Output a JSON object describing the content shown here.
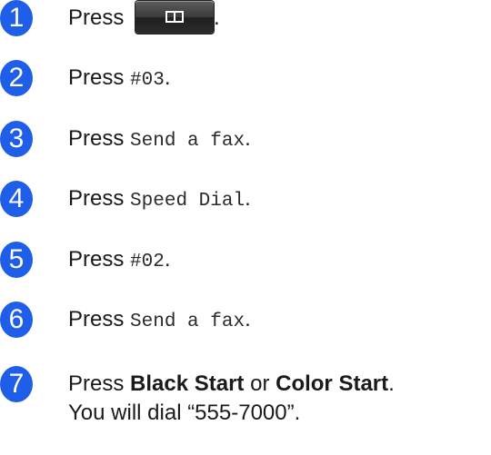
{
  "steps": [
    {
      "number": "1",
      "prefix": "Press",
      "suffix": "."
    },
    {
      "number": "2",
      "prefix": "Press",
      "code": "#03",
      "suffix": "."
    },
    {
      "number": "3",
      "prefix": "Press",
      "code": "Send a fax",
      "suffix": "."
    },
    {
      "number": "4",
      "prefix": "Press",
      "code": "Speed Dial",
      "suffix": "."
    },
    {
      "number": "5",
      "prefix": "Press",
      "code": "#02",
      "suffix": "."
    },
    {
      "number": "6",
      "prefix": "Press",
      "code": "Send a fax",
      "suffix": "."
    },
    {
      "number": "7",
      "prefix": "Press",
      "bold1": "Black Start",
      "or": "or",
      "bold2": "Color Start",
      "suffix": ".",
      "line2": "You will dial “555-7000”."
    }
  ],
  "address_book_button": {
    "icon": "address-book-icon"
  },
  "colors": {
    "bullet": "#1f5ee8",
    "button": "#2e2e2e"
  }
}
